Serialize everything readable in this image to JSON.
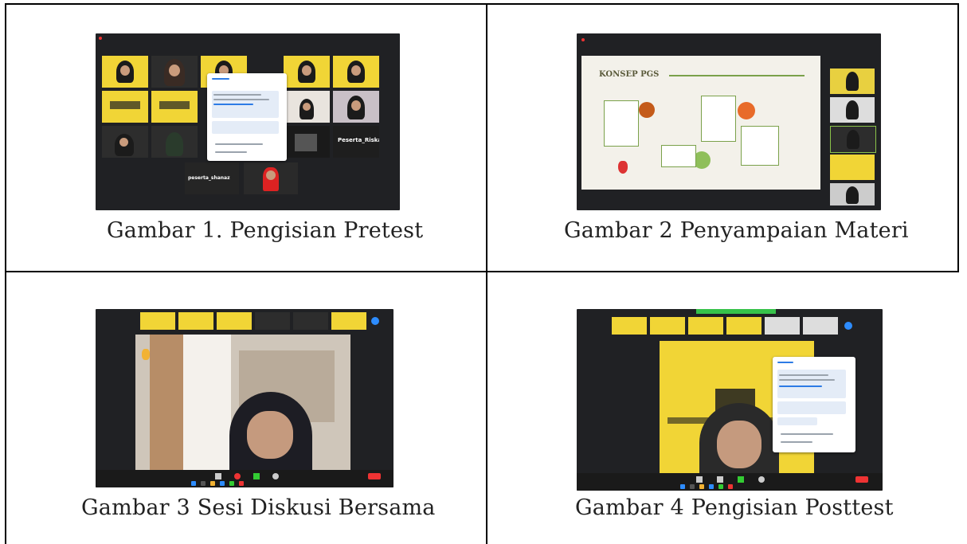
{
  "figures": [
    {
      "caption": "Gambar 1. Pengisian Pretest",
      "participants": [
        "peserta_shanaz",
        "Peserta_Riska"
      ]
    },
    {
      "caption": "Gambar 2 Penyampaian Materi",
      "slide_title": "KONSEP PGS"
    },
    {
      "caption": "Gambar 3 Sesi Diskusi Bersama"
    },
    {
      "caption": "Gambar 4 Pengisian Posttest"
    }
  ],
  "colors": {
    "border": "#000000",
    "zoom_background": "#202124",
    "poster_yellow": "#f1d536",
    "slide_background": "#f3f1ea",
    "caption_text": "#222222"
  }
}
